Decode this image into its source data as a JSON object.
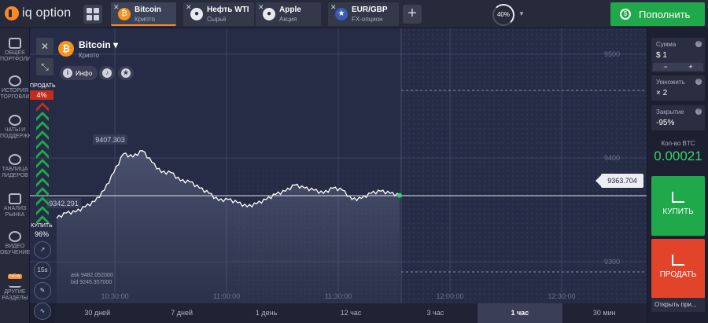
{
  "brand": {
    "logo_text": "iq option"
  },
  "tabs": [
    {
      "name": "Bitcoin",
      "sub": "Крипто",
      "icon": "bitcoin-icon",
      "color": "#f7931a",
      "active": true
    },
    {
      "name": "Нефть WTI",
      "sub": "Сырьё",
      "icon": "oil-drop-icon",
      "color": "#cfd3de",
      "active": false
    },
    {
      "name": "Apple",
      "sub": "Акция",
      "icon": "apple-icon",
      "color": "#cfd3de",
      "active": false
    },
    {
      "name": "EUR/GBP",
      "sub": "FX-опцион",
      "icon": "eu-gb-flags-icon",
      "color": "#3b5bb5",
      "active": false
    }
  ],
  "header": {
    "gauge_label": "40%",
    "deposit_label": "Пополнить"
  },
  "leftnav": {
    "items": [
      {
        "label": "ОБЩЕЕ ПОРТФОЛИО",
        "icon": "portfolio-icon"
      },
      {
        "label": "ИСТОРИЯ ТОРГОВЛИ",
        "icon": "history-icon"
      },
      {
        "label": "ЧАТЫ И ПОДДЕРЖКА",
        "icon": "chat-icon"
      },
      {
        "label": "ТАБЛИЦА ЛИДЕРОВ",
        "icon": "leaderboard-icon"
      },
      {
        "label": "АНАЛИЗ РЫНКА",
        "icon": "analysis-icon"
      },
      {
        "label": "ВИДЕО ОБУЧЕНИЕ",
        "icon": "video-icon"
      },
      {
        "label": "ДРУГИЕ РАЗДЕЛЫ",
        "icon": "more-icon",
        "badge": "NEW"
      }
    ]
  },
  "asset": {
    "name": "Bitcoin",
    "sub": "Крипто",
    "info_label": "Инфо"
  },
  "sentiment": {
    "sell_label": "ПРОДАТЬ",
    "sell_pct": "4%",
    "buy_label": "КУПИТЬ",
    "buy_pct": "96%"
  },
  "side_tools": {
    "timeframe": "15s"
  },
  "chart": {
    "current_price": "9363.704",
    "max_label": "9407.303",
    "min_label": "9342.291",
    "ask": "ask 9482.052000",
    "bid": "bid 9245.357000",
    "y_ticks": [
      "9500",
      "9400",
      "9300"
    ],
    "x_ticks": [
      "10:30:00",
      "11:00:00",
      "11:30:00",
      "12:00:00",
      "12:30:00"
    ]
  },
  "chart_data": {
    "type": "area",
    "title": "Bitcoin",
    "xlabel": "",
    "ylabel": "",
    "ylim": [
      9260,
      9525
    ],
    "y_ticks": [
      9500,
      9400,
      9300
    ],
    "x_ticks": [
      "10:30:00",
      "11:00:00",
      "11:30:00",
      "12:00:00",
      "12:30:00"
    ],
    "series": [
      {
        "values": [
          9342,
          9347,
          9348,
          9353,
          9358,
          9369,
          9386,
          9404,
          9401,
          9407,
          9396,
          9386,
          9386,
          9378,
          9377,
          9371,
          9366,
          9359,
          9360,
          9357,
          9353,
          9356,
          9360,
          9365,
          9368,
          9374,
          9371,
          9369,
          9366,
          9371,
          9369,
          9360,
          9361,
          9366,
          9368,
          9366,
          9364
        ]
      }
    ],
    "current": 9363.704,
    "annotations": [
      "9407.303",
      "9342.291"
    ],
    "grid": true
  },
  "timeframes": [
    "30 дней",
    "7 дней",
    "1 день",
    "12 час",
    "3 час",
    "1 час",
    "30 мин"
  ],
  "active_timeframe": "1 час",
  "right_panel": {
    "amount_label": "Сумма",
    "amount_value": "$ 1",
    "multiplier_label": "Умножить",
    "multiplier_value": "× 2",
    "close_label": "Закрытие",
    "close_value": "-95%",
    "profit_label": "Кол-во BTC",
    "profit_value": "0.00021",
    "buy_label": "КУПИТЬ",
    "sell_label": "ПРОДАТЬ",
    "open_label": "Открыть при..."
  },
  "colors": {
    "buy": "#1fa94a",
    "sell": "#e1442a",
    "accent": "#ff8a1e",
    "profit": "#37d46d"
  }
}
